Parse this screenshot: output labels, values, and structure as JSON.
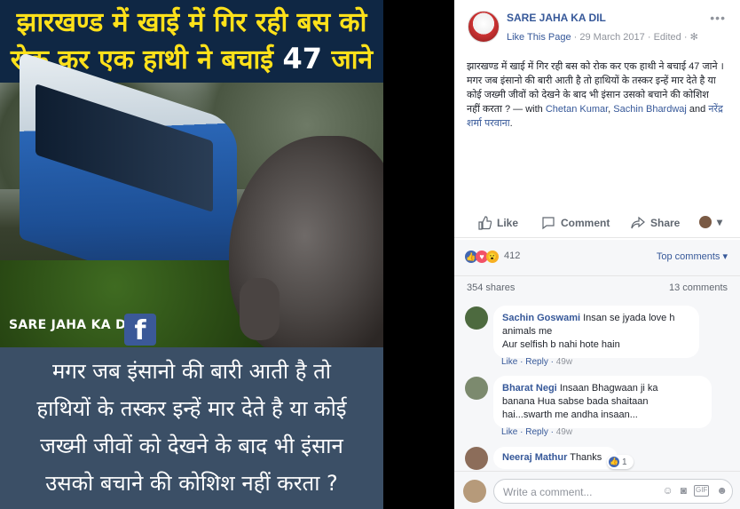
{
  "image": {
    "headline_line1": "झारखण्ड में खाई में गिर रही बस को",
    "headline_line2": "रोक कर एक हाथी ने बचाई",
    "headline_number": "47",
    "headline_suffix": "जाने",
    "watermark": "SARE JAHA KA DIL",
    "fb_glyph": "f",
    "bottom_lines": [
      "मगर जब इंसानो की बारी आती है तो",
      "हाथियों के तस्कर इन्हें मार देते है या कोई",
      "जख्मी जीवों को देखने के बाद भी इंसान",
      "उसको बचाने की कोशिश नहीं करता ?"
    ]
  },
  "post": {
    "page_name": "SARE JAHA KA DIL",
    "like_this_page": "Like This Page",
    "dot1": "·",
    "date": "29 March 2017",
    "dot2": "·",
    "edited": "Edited",
    "dot3": "·",
    "privacy_icon": "gear-icon",
    "more": "•••",
    "text_line1": "झारखण्ड में खाई में गिर रही बस को रोक कर एक हाथी ने बचाई 47 जाने ।",
    "text_line2": "मगर जब इंसानो की बारी आती है तो हाथियों के तस्कर इन्हें मार देते है या कोई जख्मी जीवों को देखने के बाद भी इंसान उसको बचाने की कोशिश नहीं करता ? —",
    "with_label": "with",
    "tag1": "Chetan Kumar",
    "comma": ",",
    "tag2": "Sachin Bhardwaj",
    "and_label": "and",
    "tag3": "नरेंद्र शर्मा परवाना",
    "period": "."
  },
  "actions": {
    "like": "Like",
    "comment": "Comment",
    "share": "Share"
  },
  "reactions": {
    "count": "412",
    "top_comments": "Top comments ▾",
    "shares": "354 shares",
    "comments_count": "13 comments"
  },
  "comments": [
    {
      "name": "Sachin Goswami",
      "text1": "Insan se jyada love h",
      "text2": "animals me",
      "text3": "Aur selfish b nahi hote hain",
      "like": "Like",
      "reply": "Reply",
      "time": "49w"
    },
    {
      "name": "Bharat Negi",
      "text1": "Insaan Bhagwaan ji ka",
      "text2": "banana Hua sabse bada shaitaan",
      "text3": "hai...swarth me andha insaan...",
      "like": "Like",
      "reply": "Reply",
      "time": "49w"
    },
    {
      "name": "Neeraj Mathur",
      "text1": "Thanks",
      "badge_count": "1"
    }
  ],
  "composer": {
    "placeholder": "Write a comment...",
    "icons": [
      "emoji-icon",
      "camera-icon",
      "gif-icon",
      "sticker-icon"
    ]
  },
  "colors": {
    "link": "#365899",
    "meta": "#90949c",
    "bg": "#f6f7f9"
  }
}
